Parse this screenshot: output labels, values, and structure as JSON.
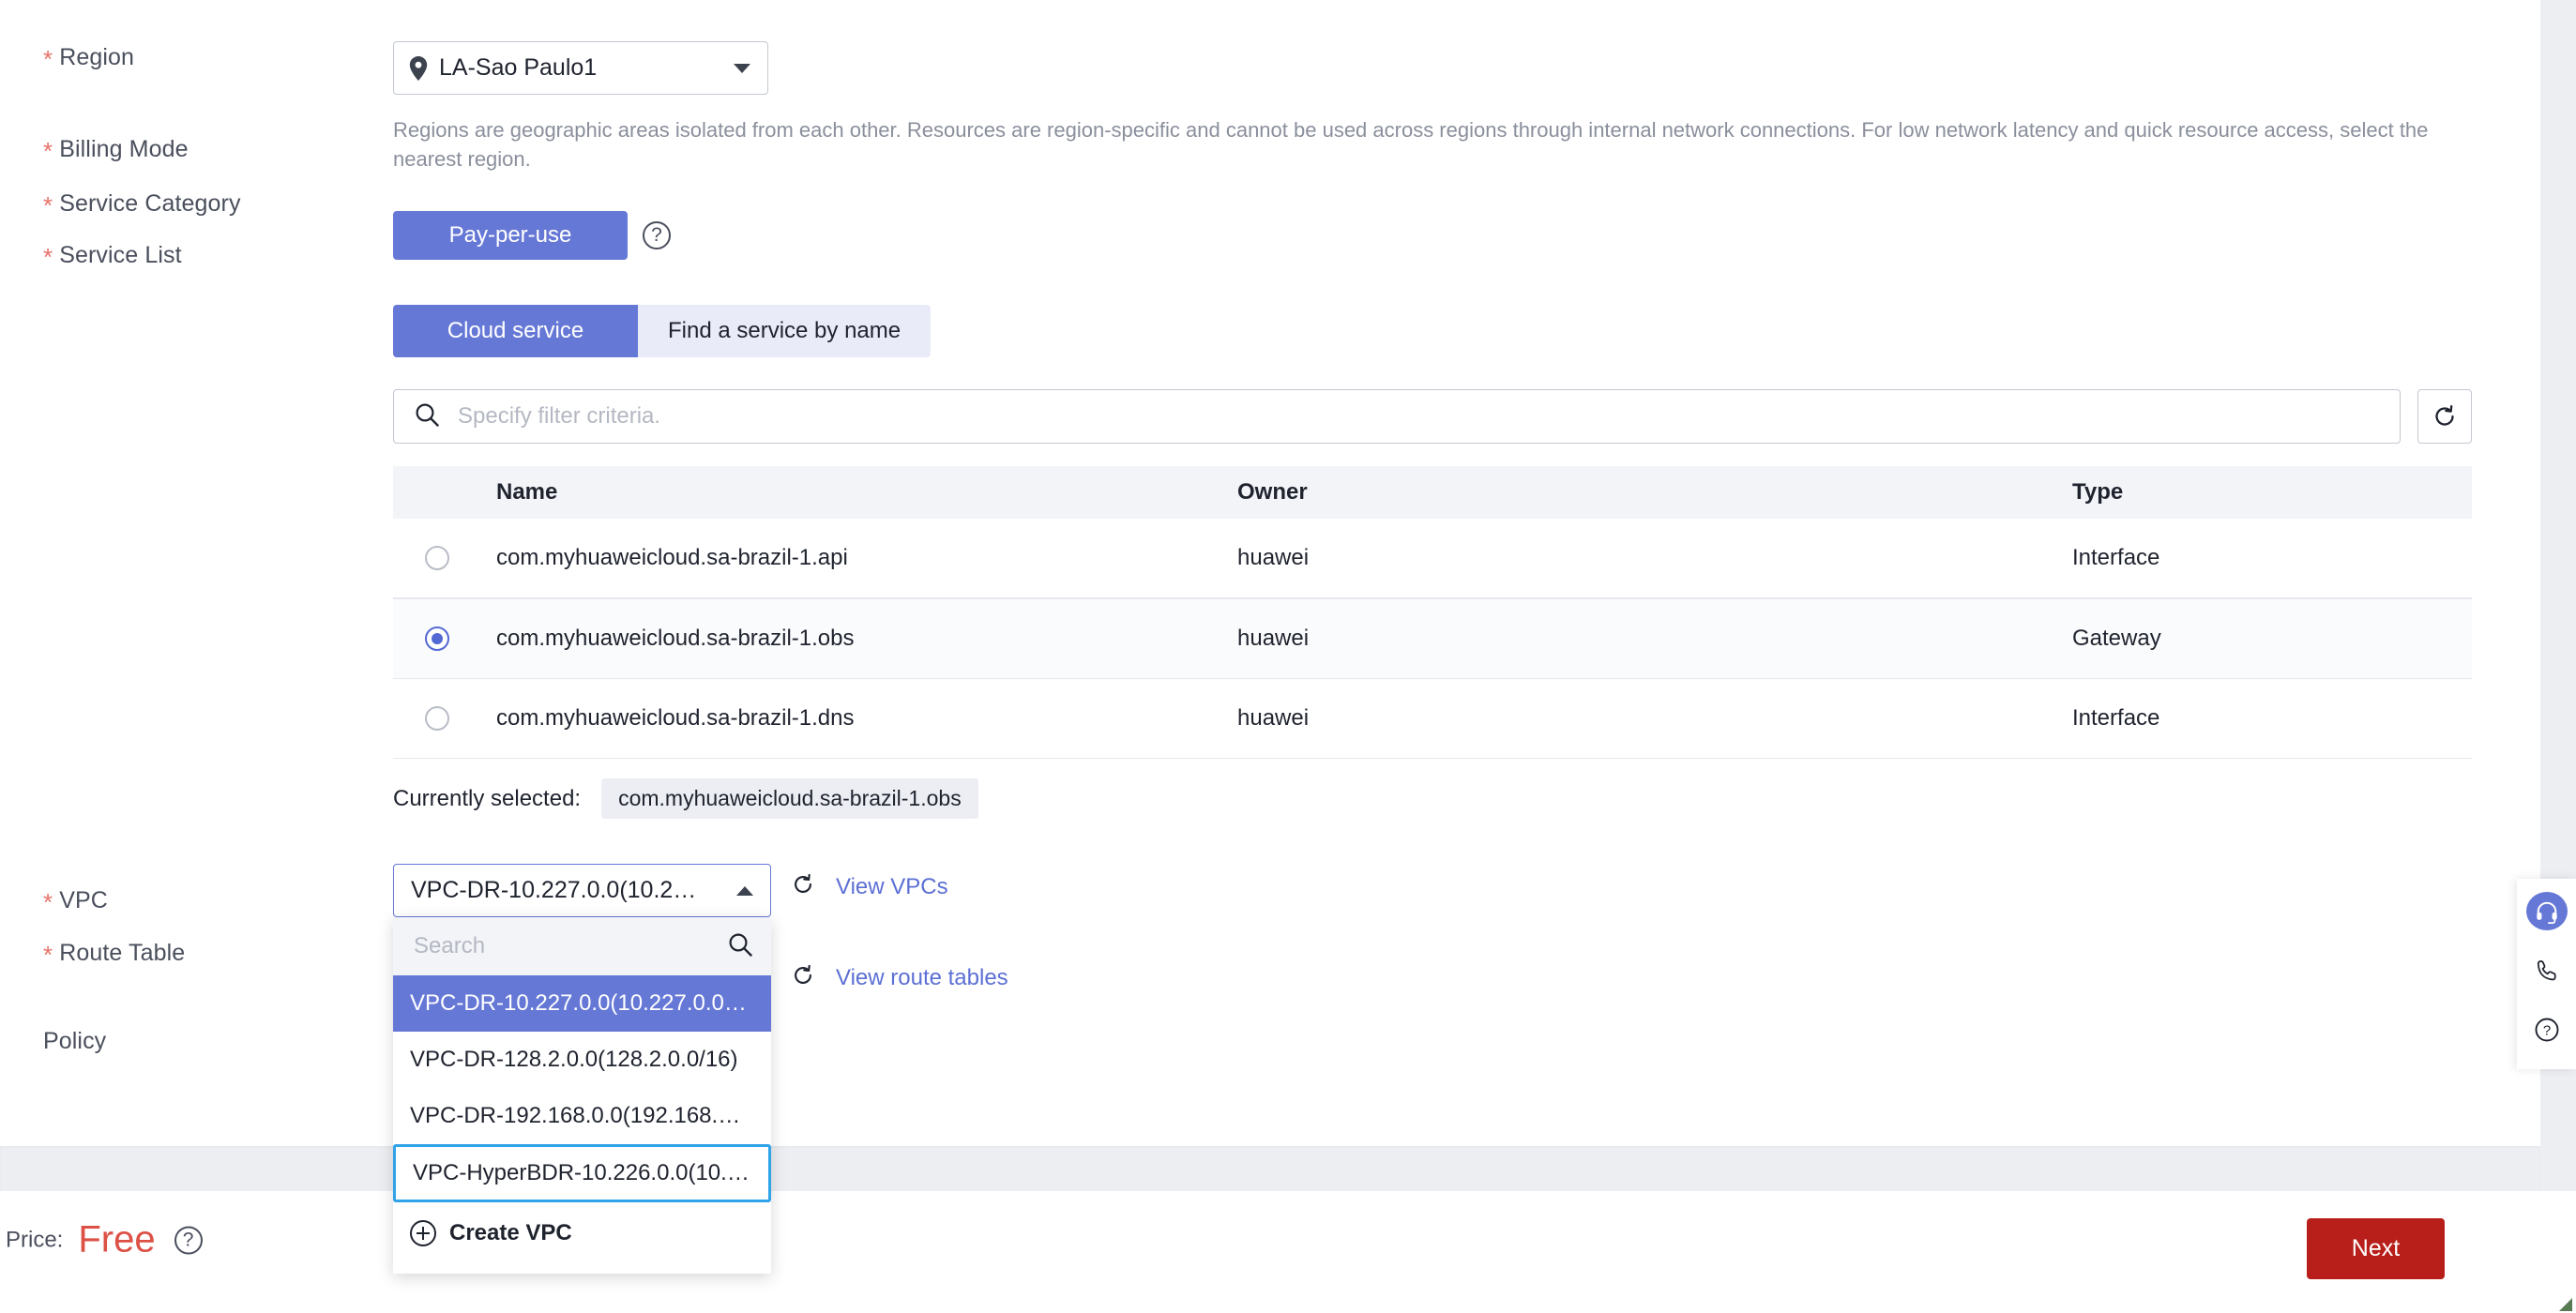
{
  "form": {
    "region": {
      "label": "Region",
      "required": true,
      "value": "LA-Sao Paulo1",
      "icon": "location-pin-icon",
      "hint": "Regions are geographic areas isolated from each other. Resources are region-specific and cannot be used across regions through internal network connections. For low network latency and quick resource access, select the nearest region."
    },
    "billing_mode": {
      "label": "Billing Mode",
      "required": true,
      "selected": "Pay-per-use",
      "help_icon": "question-circle-icon"
    },
    "service_category": {
      "label": "Service Category",
      "required": true,
      "options": [
        "Cloud service",
        "Find a service by name"
      ],
      "selected": "Cloud service"
    },
    "service_list": {
      "label": "Service List",
      "required": true,
      "filter_placeholder": "Specify filter criteria.",
      "filter_value": "",
      "search_icon": "search-icon",
      "refresh_icon": "refresh-icon",
      "columns": [
        "Name",
        "Owner",
        "Type"
      ],
      "rows": [
        {
          "name": "com.myhuaweicloud.sa-brazil-1.api",
          "owner": "huawei",
          "type": "Interface",
          "selected": false
        },
        {
          "name": "com.myhuaweicloud.sa-brazil-1.obs",
          "owner": "huawei",
          "type": "Gateway",
          "selected": true
        },
        {
          "name": "com.myhuaweicloud.sa-brazil-1.dns",
          "owner": "huawei",
          "type": "Interface",
          "selected": false
        }
      ],
      "currently_selected_label": "Currently selected:",
      "currently_selected_value": "com.myhuaweicloud.sa-brazil-1.obs"
    },
    "vpc": {
      "label": "VPC",
      "required": true,
      "value": "VPC-DR-10.227.0.0(10.2…",
      "expanded": true,
      "link": "View VPCs",
      "link_refresh_icon": "refresh-icon",
      "dropdown": {
        "search_placeholder": "Search",
        "search_value": "",
        "search_icon": "search-icon",
        "options": [
          {
            "label": "VPC-DR-10.227.0.0(10.227.0.0…",
            "state": "selected"
          },
          {
            "label": "VPC-DR-128.2.0.0(128.2.0.0/16)",
            "state": "normal"
          },
          {
            "label": "VPC-DR-192.168.0.0(192.168.…",
            "state": "normal"
          },
          {
            "label": "VPC-HyperBDR-10.226.0.0(10.…",
            "state": "focused"
          }
        ],
        "create_label": "Create VPC",
        "create_icon": "plus-circle-icon"
      }
    },
    "route_table": {
      "label": "Route Table",
      "required": true,
      "link": "View route tables",
      "link_refresh_icon": "refresh-icon"
    },
    "policy": {
      "label": "Policy",
      "required": false
    }
  },
  "footer": {
    "price_label": "Price:",
    "price_value": "Free",
    "price_help_icon": "question-circle-icon",
    "next_label": "Next"
  },
  "float_toolbar": {
    "items": [
      {
        "icon": "headset-icon",
        "primary": true
      },
      {
        "icon": "phone-icon",
        "primary": false
      },
      {
        "icon": "question-circle-icon",
        "primary": false
      }
    ]
  },
  "colors": {
    "accent": "#6678d6",
    "required_star": "#e8726a",
    "link": "#5c6fd4",
    "next_button": "#b81f1b",
    "price": "#dd5045",
    "focus_outline": "#30a2e8"
  }
}
